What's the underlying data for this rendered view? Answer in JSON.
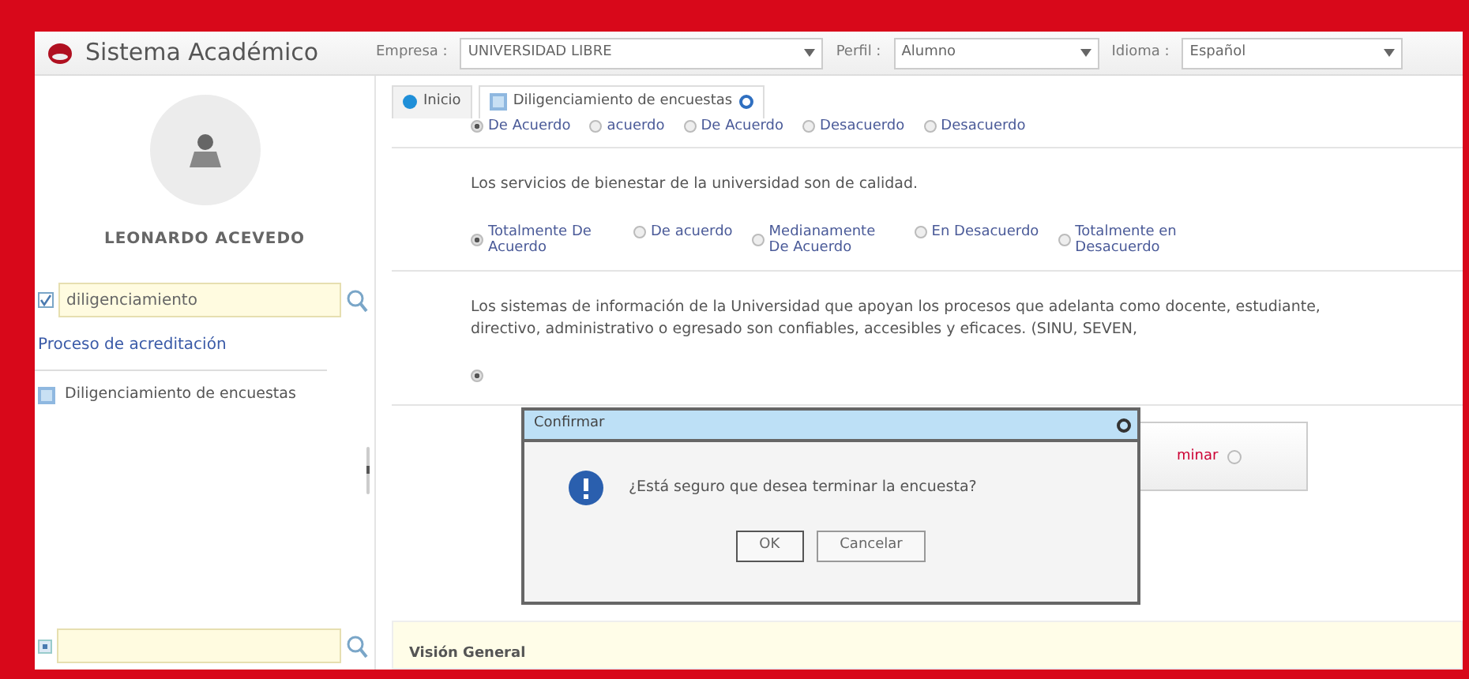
{
  "header": {
    "app_title": "Sistema Académico",
    "filters": [
      {
        "label": "Empresa :",
        "value": "UNIVERSIDAD LIBRE"
      },
      {
        "label": "Perfil :",
        "value": "Alumno"
      },
      {
        "label": "Idioma :",
        "value": "Español"
      }
    ]
  },
  "sidebar": {
    "user_name": "LEONARDO ACEVEDO",
    "search": {
      "value": "diligenciamiento",
      "checked": true
    },
    "link": "Proceso de acreditación",
    "menu_items": [
      {
        "label": "Diligenciamiento de encuestas"
      }
    ]
  },
  "tabs": [
    {
      "label": "Inicio",
      "selected": false
    },
    {
      "label": "Diligenciamiento de encuestas",
      "selected": true
    }
  ],
  "questions": [
    {
      "options": [
        {
          "label": "De Acuerdo",
          "selected": true
        },
        {
          "label": "acuerdo",
          "selected": false
        },
        {
          "label": "De Acuerdo",
          "selected": false
        },
        {
          "label": "Desacuerdo",
          "selected": false
        },
        {
          "label": "Desacuerdo",
          "selected": false
        }
      ]
    },
    {
      "text": "Los servicios de bienestar de la universidad son de calidad.",
      "options": [
        {
          "label": "Totalmente De Acuerdo",
          "selected": true
        },
        {
          "label": "De acuerdo",
          "selected": false
        },
        {
          "label": "Medianamente De Acuerdo",
          "selected": false
        },
        {
          "label": "En Desacuerdo",
          "selected": false
        },
        {
          "label": "Totalmente en Desacuerdo",
          "selected": false
        }
      ]
    },
    {
      "text": "Los sistemas de información de la Universidad que apoyan los procesos que adelanta como docente, estudiante, directivo, administrativo o egresado son confiables, accesibles y eficaces. (SINU, SEVEN,",
      "options": [
        {
          "selected": true
        }
      ]
    }
  ],
  "finish_button": {
    "label": "minar"
  },
  "panel_title": "Visión General",
  "dialog": {
    "title": "Confirmar",
    "message": "¿Está seguro que desea terminar la encuesta?",
    "buttons": [
      "OK",
      "Cancelar"
    ]
  }
}
